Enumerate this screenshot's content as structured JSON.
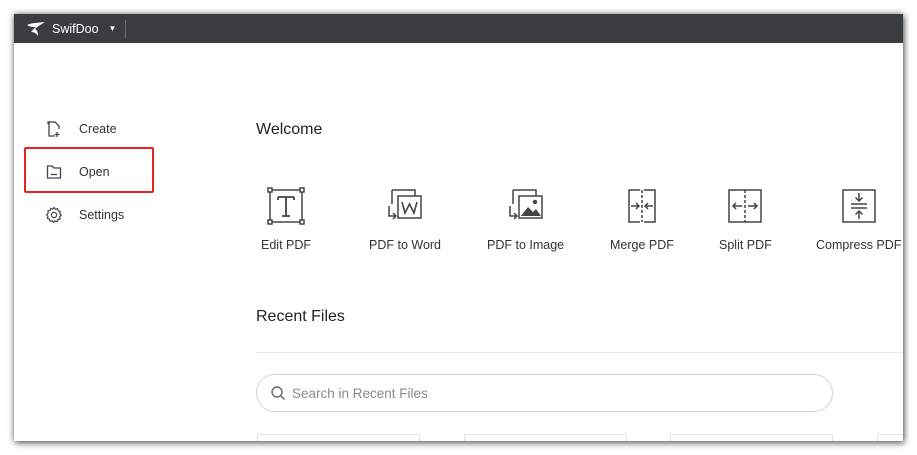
{
  "app": {
    "name": "SwifDoo",
    "colors": {
      "titlebar": "#3a3d40",
      "highlight": "#e62222",
      "icon": "#444444"
    }
  },
  "sidebar": {
    "items": [
      {
        "label": "Create",
        "icon": "create-file-icon"
      },
      {
        "label": "Open",
        "icon": "folder-open-icon"
      },
      {
        "label": "Settings",
        "icon": "gear-icon"
      }
    ]
  },
  "main": {
    "welcome_title": "Welcome",
    "tools": [
      {
        "label": "Edit PDF",
        "icon": "edit-text-icon"
      },
      {
        "label": "PDF to Word",
        "icon": "pdf-to-word-icon"
      },
      {
        "label": "PDF to Image",
        "icon": "pdf-to-image-icon"
      },
      {
        "label": "Merge PDF",
        "icon": "merge-icon"
      },
      {
        "label": "Split PDF",
        "icon": "split-icon"
      },
      {
        "label": "Compress PDF",
        "icon": "compress-icon"
      }
    ],
    "recent_title": "Recent Files",
    "search": {
      "placeholder": "Search in Recent Files",
      "value": ""
    }
  }
}
